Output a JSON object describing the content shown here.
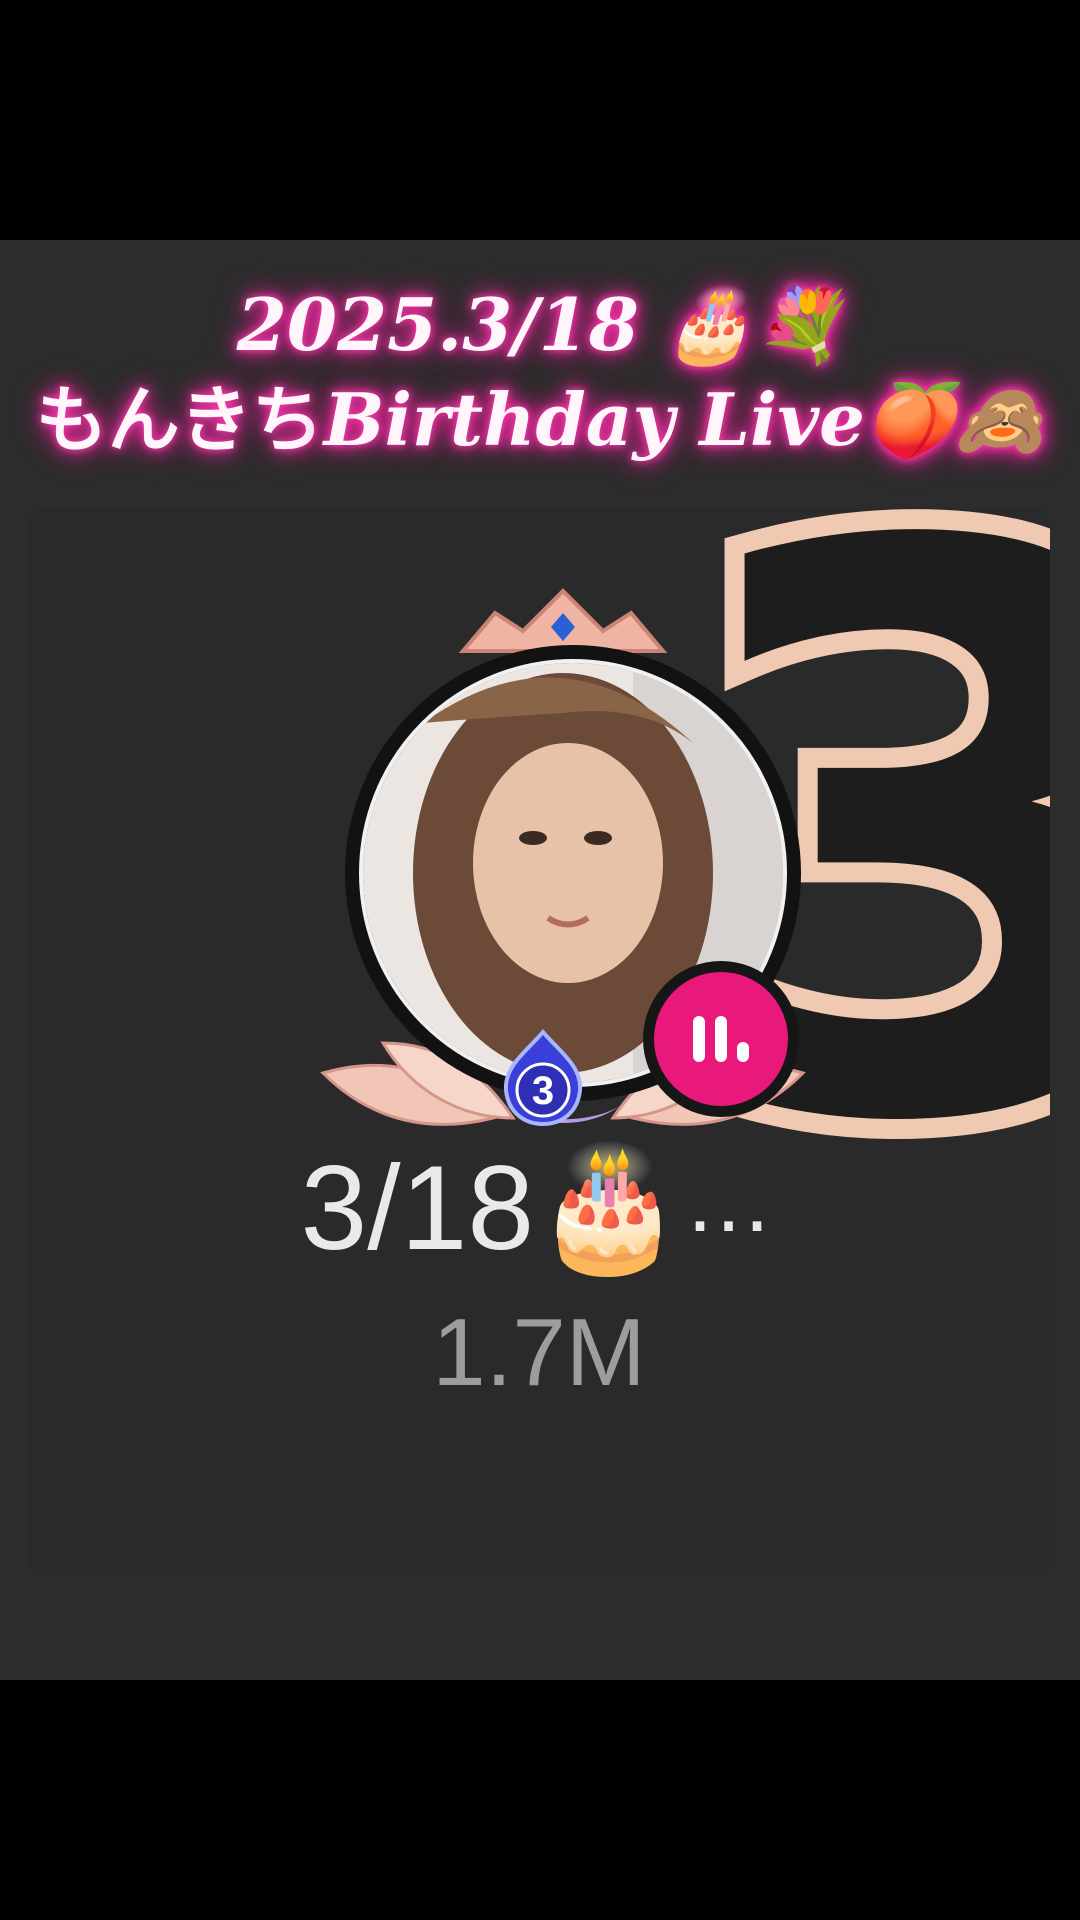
{
  "title": {
    "line1": "2025.3/18 🎂💐",
    "line2_jp": "もんきち",
    "line2_en": "Birthday Live🍑🙈"
  },
  "card": {
    "rank": "3",
    "level": "3",
    "name": "3/18🎂",
    "more": "…",
    "viewers": "1.7M"
  },
  "colors": {
    "neon_glow": "#ff2aa6",
    "live_badge": "#e8197b",
    "rank_stroke": "#efc9b1",
    "card_bg": "#2a2a2a"
  },
  "icons": [
    "crown-icon",
    "live-audio-icon",
    "level-flame-badge-icon",
    "lotus-frame-icon"
  ]
}
